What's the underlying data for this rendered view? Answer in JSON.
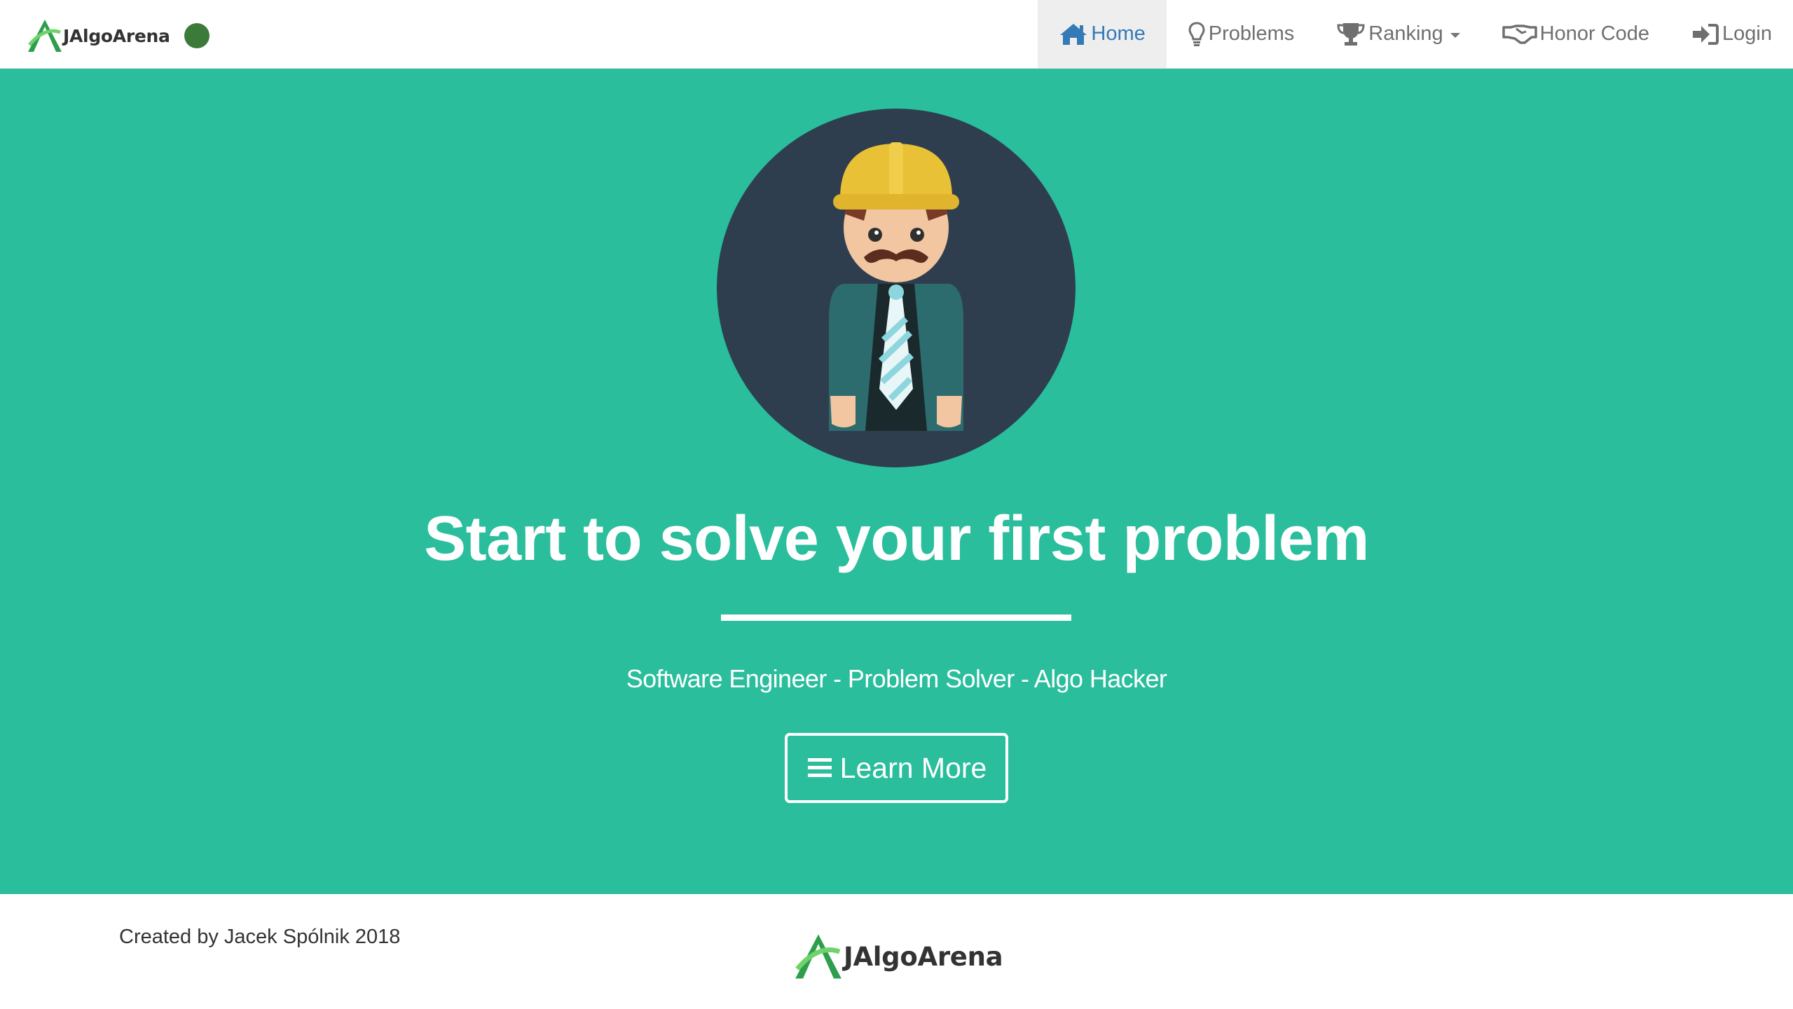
{
  "brand": {
    "name": "JAlgoArena",
    "status_color": "#3c7a3a"
  },
  "nav": {
    "items": [
      {
        "label": "Home",
        "icon": "home-icon",
        "active": true
      },
      {
        "label": "Problems",
        "icon": "lightbulb-icon",
        "active": false
      },
      {
        "label": "Ranking",
        "icon": "trophy-icon",
        "active": false,
        "dropdown": true
      },
      {
        "label": "Honor Code",
        "icon": "handshake-icon",
        "active": false
      },
      {
        "label": "Login",
        "icon": "login-icon",
        "active": false
      }
    ]
  },
  "hero": {
    "headline": "Start to solve your first problem",
    "subtitle": "Software Engineer - Problem Solver - Algo Hacker",
    "button_label": "Learn More",
    "background": "#2abe9c",
    "avatar": "engineer-avatar-icon"
  },
  "footer": {
    "credit": "Created by Jacek Spólnik 2018",
    "logo_text": "JAlgoArena"
  },
  "colors": {
    "accent": "#337ab7",
    "hero_bg": "#2abe9c",
    "avatar_bg": "#2f3e4f"
  }
}
